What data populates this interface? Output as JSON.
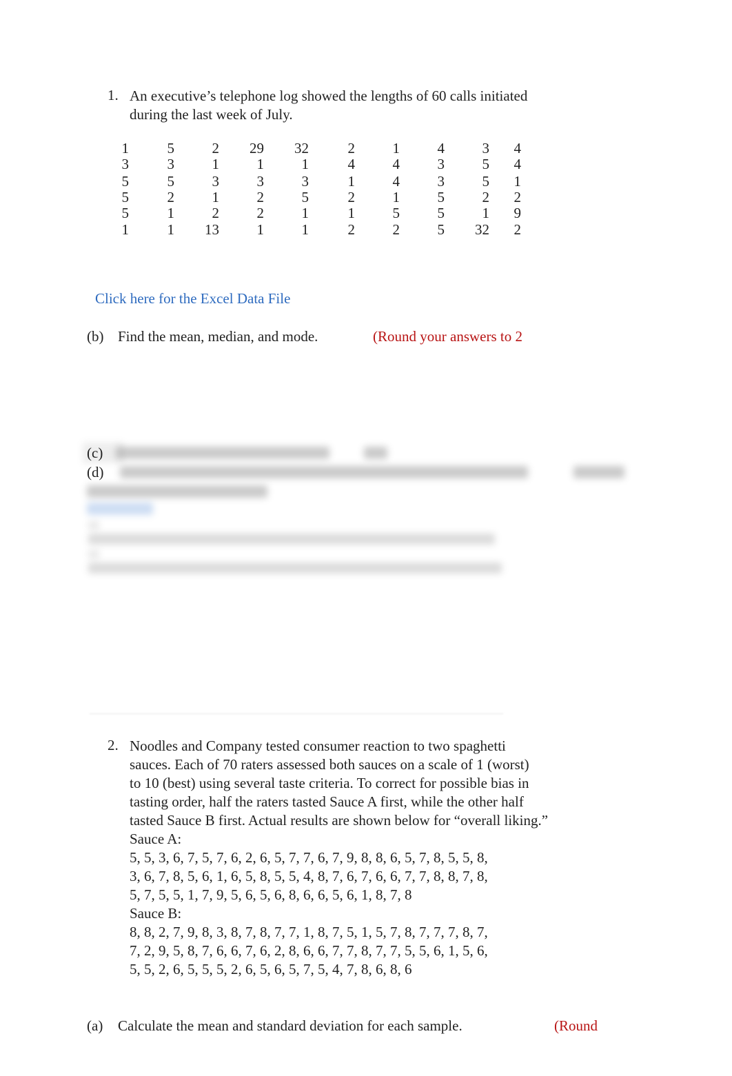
{
  "q1": {
    "number": "1.",
    "text_lines": [
      "An executive’s telephone log showed the lengths of 60 calls initiated",
      "during the last week of July."
    ],
    "table": [
      [
        "1",
        "5",
        "2",
        "29",
        "32",
        "2",
        "1",
        "4",
        "3",
        "4"
      ],
      [
        "3",
        "3",
        "1",
        "1",
        "1",
        "4",
        "4",
        "3",
        "5",
        "4"
      ],
      [
        "5",
        "5",
        "3",
        "3",
        "3",
        "1",
        "4",
        "3",
        "5",
        "1"
      ],
      [
        "5",
        "2",
        "1",
        "2",
        "5",
        "2",
        "1",
        "5",
        "2",
        "2"
      ],
      [
        "5",
        "1",
        "2",
        "2",
        "1",
        "1",
        "5",
        "5",
        "1",
        "9"
      ],
      [
        "1",
        "1",
        "13",
        "1",
        "1",
        "2",
        "2",
        "5",
        "32",
        "2"
      ]
    ],
    "excel_link": "Click here for the Excel Data File",
    "part_b": {
      "label": "(b)",
      "text": "Find the mean, median, and mode.",
      "note": "(Round your answers to 2"
    },
    "part_c": {
      "label": "(c)"
    },
    "part_d": {
      "label": "(d)"
    }
  },
  "q2": {
    "number": "2.",
    "text_lines": [
      "Noodles and Company tested consumer reaction to two spaghetti",
      "sauces. Each of 70 raters assessed both sauces on a scale of 1 (worst)",
      "to 10 (best) using several taste criteria. To correct for possible bias in",
      "tasting order, half the raters tasted Sauce A first, while the other half",
      "tasted Sauce B first. Actual results are shown below for “overall liking.”",
      "Sauce A:",
      "5, 5, 3, 6, 7, 5, 7, 6, 2, 6, 5, 7, 7, 6, 7, 9, 8, 8, 6, 5, 7, 8, 5, 5, 8,",
      "3, 6, 7, 8, 5, 6, 1, 6, 5, 8, 5, 5, 4, 8, 7, 6, 7, 6, 6, 7, 7, 8, 8, 7, 8,",
      "5, 7, 5, 5, 1, 7, 9, 5, 6, 5, 6, 8, 6, 6, 5, 6, 1, 8, 7, 8",
      "Sauce B:",
      "8, 8, 2, 7, 9, 8, 3, 8, 7, 8, 7, 7, 1, 8, 7, 5, 1, 5, 7, 8, 7, 7, 7, 8, 7,",
      "7, 2, 9, 5, 8, 7, 6, 6, 7, 6, 2, 8, 6, 6, 7, 7, 8, 7, 7, 5, 5, 6, 1, 5, 6,",
      "5, 5, 2, 6, 5, 5, 5, 2, 6, 5, 6, 5, 7, 5, 4, 7, 8, 6, 8, 6"
    ],
    "part_a": {
      "label": "(a)",
      "text": "Calculate the mean and standard deviation for each sample.",
      "note": "(Round"
    }
  },
  "colors": {
    "link": "#2e6bbf",
    "note": "#b81414"
  }
}
